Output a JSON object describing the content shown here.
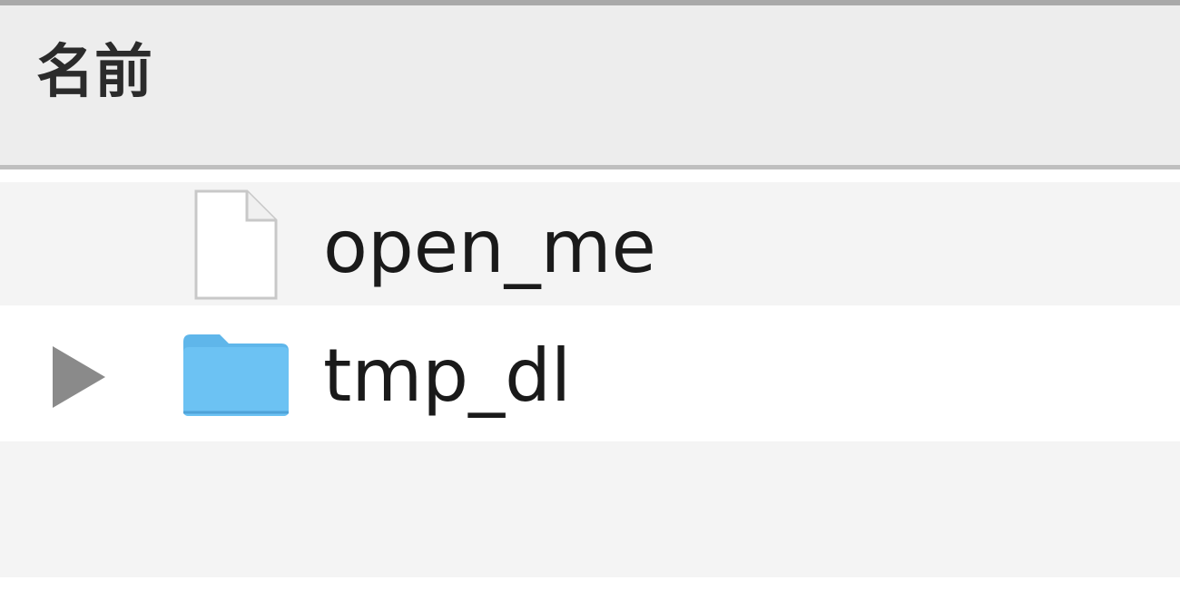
{
  "column_header": {
    "name_label": "名前"
  },
  "rows": [
    {
      "name": "open_me",
      "kind": "file",
      "icon": "document-icon"
    },
    {
      "name": "tmp_dl",
      "kind": "folder",
      "icon": "folder-icon",
      "expanded": false
    }
  ],
  "colors": {
    "folder": "#6cc2f3",
    "row_alt": "#f4f4f4",
    "header_bg": "#ededed",
    "disclosure": "#8a8a8a"
  }
}
